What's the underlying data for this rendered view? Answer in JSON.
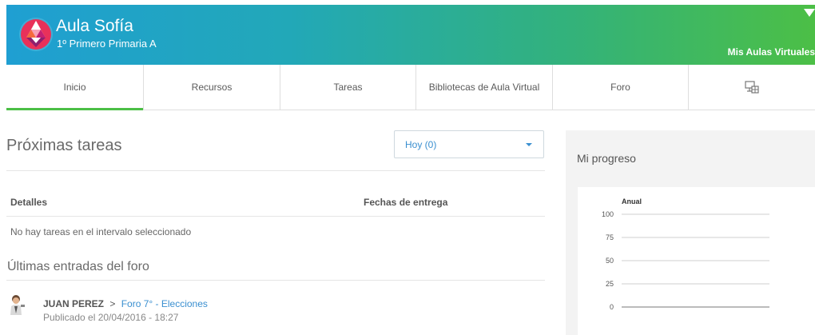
{
  "header": {
    "title": "Aula Sofía",
    "subtitle": "1º Primero Primaria A",
    "menu_label": "Mis Aulas Virtuales",
    "gradient": [
      "#1f9fd2",
      "#4cbf46"
    ]
  },
  "nav": {
    "tabs": [
      {
        "label": "Inicio",
        "active": true
      },
      {
        "label": "Recursos"
      },
      {
        "label": "Tareas"
      },
      {
        "label": "Bibliotecas de Aula Virtual"
      },
      {
        "label": "Foro"
      },
      {
        "label": "",
        "icon": "screen-grid-icon"
      }
    ],
    "active_color": "#4cbf46"
  },
  "tasks": {
    "title": "Próximas tareas",
    "filter_value": "Hoy (0)",
    "columns": [
      "Detalles",
      "Fechas de entrega"
    ],
    "empty_message": "No hay tareas en el intervalo seleccionado"
  },
  "forum": {
    "title": "Últimas entradas del foro",
    "posts": [
      {
        "author": "JUAN PEREZ",
        "separator": ">",
        "topic": "Foro 7° - Elecciones",
        "published": "Publicado el 20/04/2016 - 18:27"
      }
    ]
  },
  "progress": {
    "title": "Mi progreso",
    "chart_data": {
      "type": "line",
      "title": "Anual",
      "ylim": [
        0,
        100
      ],
      "y_ticks": [
        "100",
        "75",
        "50",
        "25",
        "0"
      ],
      "series": []
    }
  },
  "colors": {
    "link": "#3a8fd0",
    "accent": "#4cbf46"
  }
}
